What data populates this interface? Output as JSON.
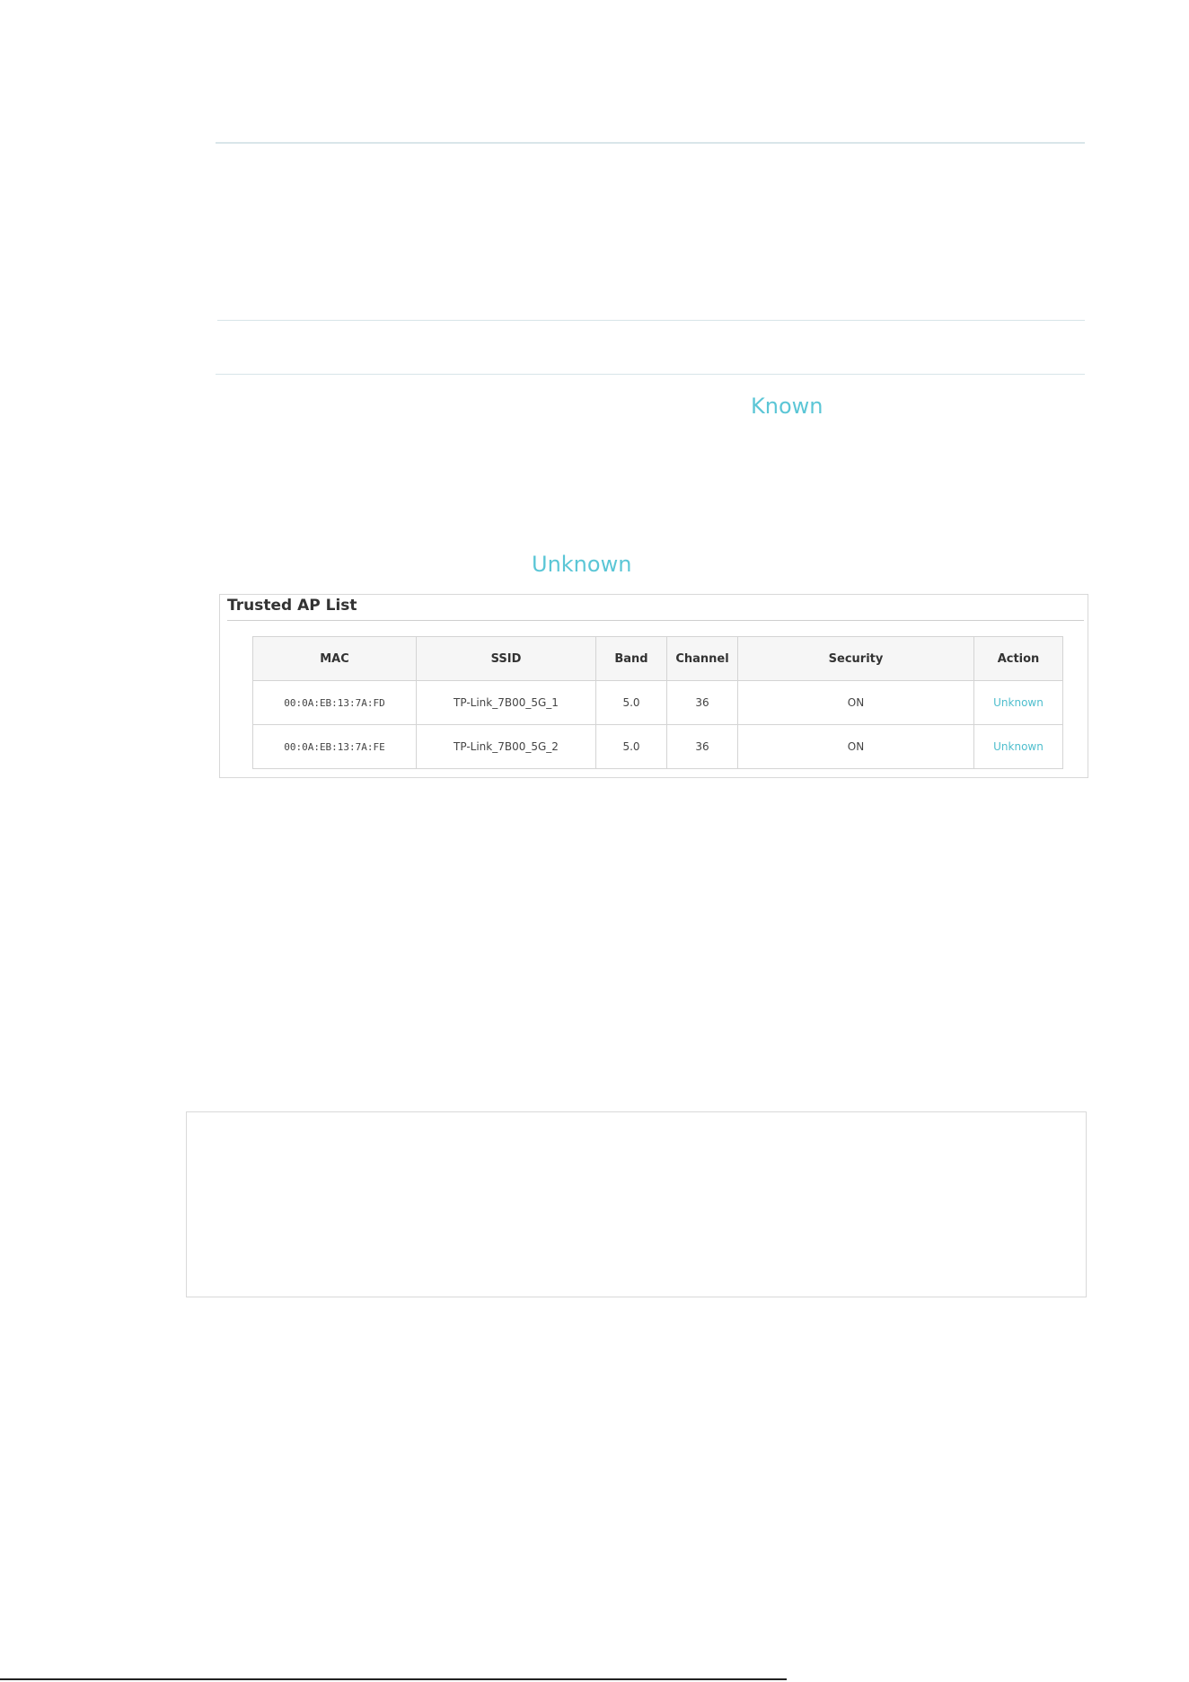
{
  "links": {
    "known": "Known",
    "unknown": "Unknown"
  },
  "trusted_ap_panel": {
    "title": "Trusted AP List",
    "columns": [
      "MAC",
      "SSID",
      "Band",
      "Channel",
      "Security",
      "Action"
    ],
    "rows": [
      {
        "mac": "00:0A:EB:13:7A:FD",
        "ssid": "TP-Link_7B00_5G_1",
        "band": "5.0",
        "channel": "36",
        "security": "ON",
        "action": "Unknown"
      },
      {
        "mac": "00:0A:EB:13:7A:FE",
        "ssid": "TP-Link_7B00_5G_2",
        "band": "5.0",
        "channel": "36",
        "security": "ON",
        "action": "Unknown"
      }
    ]
  },
  "colors": {
    "link": "#5bc6d6",
    "divider": "#d7e4e8"
  }
}
